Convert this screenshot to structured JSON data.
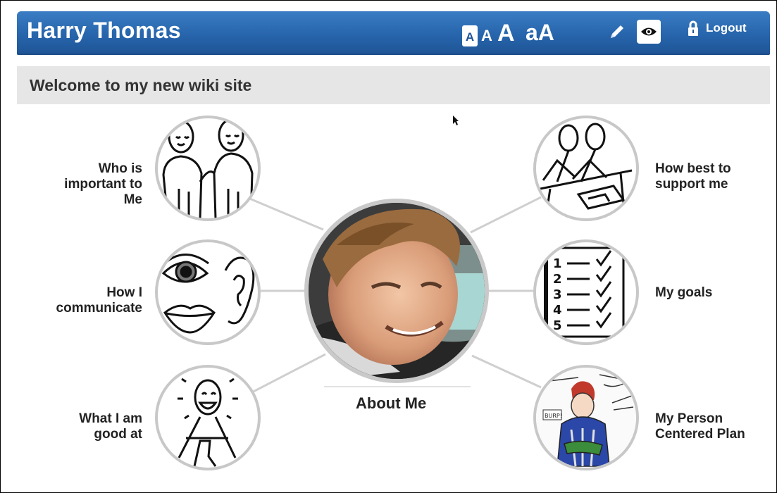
{
  "header": {
    "title": "Harry Thomas",
    "text_size_options": [
      "A",
      "A",
      "A",
      "aA"
    ],
    "logout_label": "Logout",
    "accent_color": "#2765ac"
  },
  "page": {
    "heading": "Welcome to my new wiki site"
  },
  "center": {
    "label": "About Me",
    "image": "photo-of-boy"
  },
  "nodes": {
    "who_important": {
      "label_lines": [
        "Who is",
        "important to",
        "Me"
      ],
      "icon": "two-people-icon"
    },
    "communicate": {
      "label_lines": [
        "How I",
        "communicate"
      ],
      "icon": "eye-ear-mouth-icon"
    },
    "good_at": {
      "label_lines": [
        "What I am",
        "good at"
      ],
      "icon": "smiling-person-icon"
    },
    "support": {
      "label_lines": [
        "How best to",
        "support me"
      ],
      "icon": "two-people-working-icon"
    },
    "goals": {
      "label_lines": [
        "My goals"
      ],
      "icon": "checklist-icon"
    },
    "plan": {
      "label_lines": [
        "My Person",
        "Centered Plan"
      ],
      "icon": "person-drawing-icon"
    }
  },
  "icons": {
    "pencil": "pencil-icon",
    "eye": "eye-icon",
    "lock": "lock-icon",
    "cursor": "mouse-cursor-icon"
  }
}
